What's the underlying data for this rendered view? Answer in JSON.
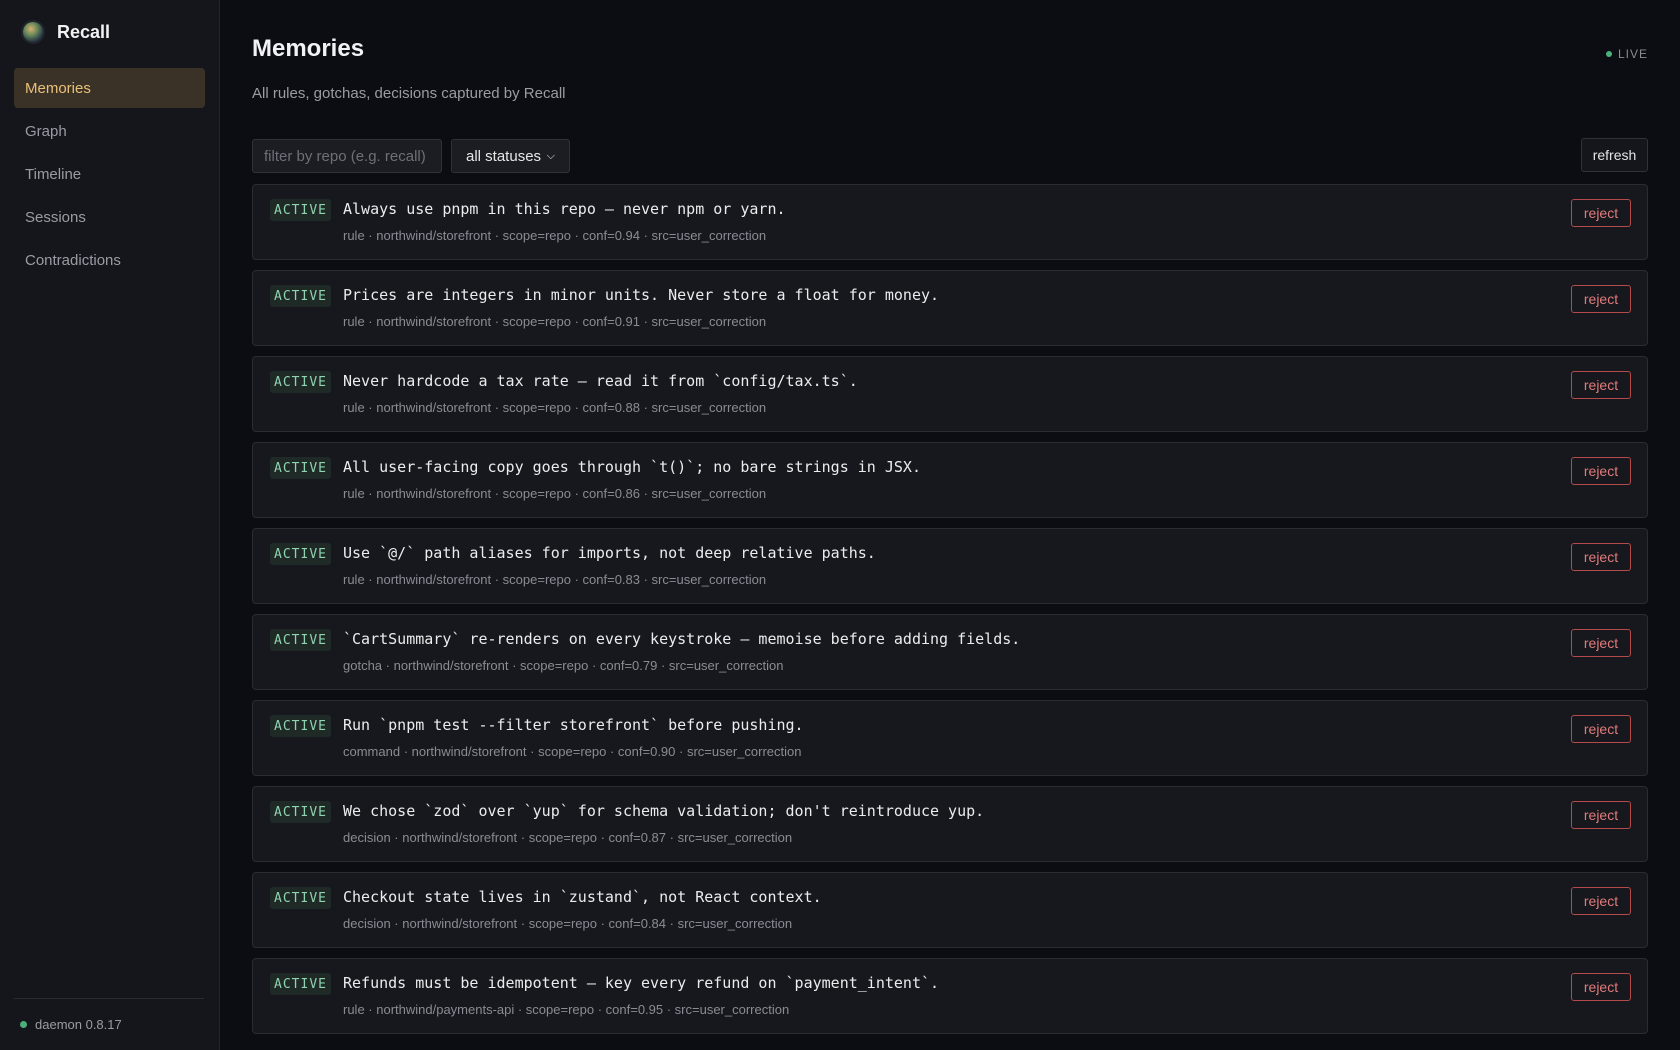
{
  "app": {
    "name": "Recall"
  },
  "sidebar": {
    "items": [
      {
        "label": "Memories",
        "active": true
      },
      {
        "label": "Graph",
        "active": false
      },
      {
        "label": "Timeline",
        "active": false
      },
      {
        "label": "Sessions",
        "active": false
      },
      {
        "label": "Contradictions",
        "active": false
      }
    ],
    "footer": {
      "status": "daemon 0.8.17",
      "status_color": "#4caf7a"
    }
  },
  "header": {
    "title": "Memories",
    "subtitle": "All rules, gotchas, decisions captured by Recall",
    "live_label": "LIVE"
  },
  "toolbar": {
    "filter_placeholder": "filter by repo (e.g. recall)",
    "filter_value": "",
    "status_selected": "all statuses",
    "refresh_label": "refresh"
  },
  "memories": [
    {
      "status": "ACTIVE",
      "text": "Always use pnpm in this repo — never npm or yarn.",
      "meta": "rule · northwind/storefront · scope=repo · conf=0.94 · src=user_correction",
      "action": "reject"
    },
    {
      "status": "ACTIVE",
      "text": "Prices are integers in minor units. Never store a float for money.",
      "meta": "rule · northwind/storefront · scope=repo · conf=0.91 · src=user_correction",
      "action": "reject"
    },
    {
      "status": "ACTIVE",
      "text": "Never hardcode a tax rate — read it from `config/tax.ts`.",
      "meta": "rule · northwind/storefront · scope=repo · conf=0.88 · src=user_correction",
      "action": "reject"
    },
    {
      "status": "ACTIVE",
      "text": "All user-facing copy goes through `t()`; no bare strings in JSX.",
      "meta": "rule · northwind/storefront · scope=repo · conf=0.86 · src=user_correction",
      "action": "reject"
    },
    {
      "status": "ACTIVE",
      "text": "Use `@/` path aliases for imports, not deep relative paths.",
      "meta": "rule · northwind/storefront · scope=repo · conf=0.83 · src=user_correction",
      "action": "reject"
    },
    {
      "status": "ACTIVE",
      "text": "`CartSummary` re-renders on every keystroke — memoise before adding fields.",
      "meta": "gotcha · northwind/storefront · scope=repo · conf=0.79 · src=user_correction",
      "action": "reject"
    },
    {
      "status": "ACTIVE",
      "text": "Run `pnpm test --filter storefront` before pushing.",
      "meta": "command · northwind/storefront · scope=repo · conf=0.90 · src=user_correction",
      "action": "reject"
    },
    {
      "status": "ACTIVE",
      "text": "We chose `zod` over `yup` for schema validation; don't reintroduce yup.",
      "meta": "decision · northwind/storefront · scope=repo · conf=0.87 · src=user_correction",
      "action": "reject"
    },
    {
      "status": "ACTIVE",
      "text": "Checkout state lives in `zustand`, not React context.",
      "meta": "decision · northwind/storefront · scope=repo · conf=0.84 · src=user_correction",
      "action": "reject"
    },
    {
      "status": "ACTIVE",
      "text": "Refunds must be idempotent — key every refund on `payment_intent`.",
      "meta": "rule · northwind/payments-api · scope=repo · conf=0.95 · src=user_correction",
      "action": "reject"
    }
  ],
  "colors": {
    "accent": "#e9c07b",
    "active_badge": "#8fd3b0",
    "reject": "#e07a7a",
    "live": "#4caf7a"
  }
}
